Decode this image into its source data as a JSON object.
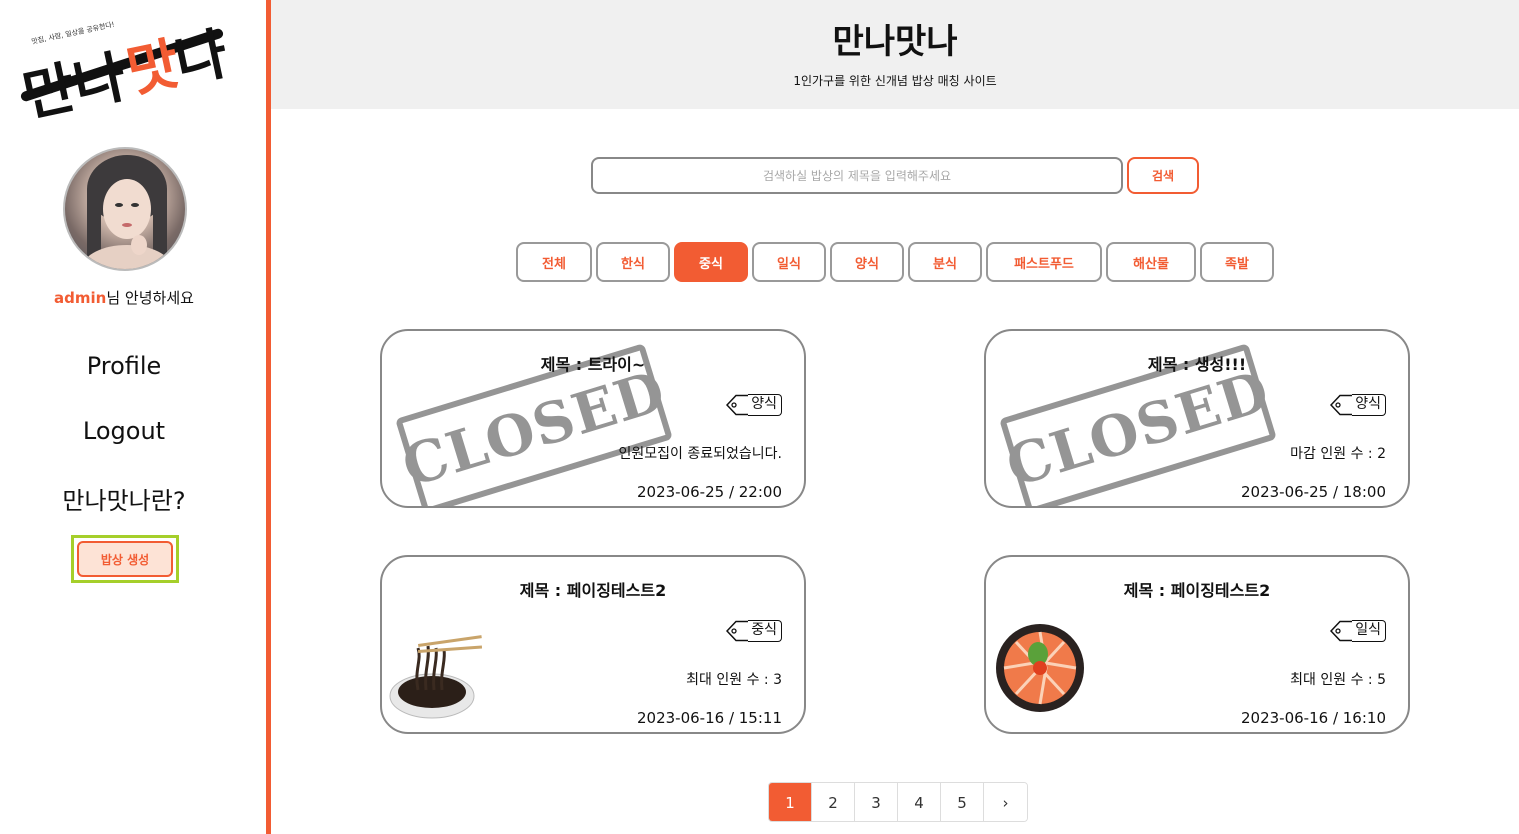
{
  "logo": {
    "tagline": "맛집, 사람, 일상을 공유한다!",
    "text_a": "만나",
    "text_b": "맛",
    "text_c": "나"
  },
  "sidebar": {
    "user": "admin",
    "greeting_suffix": "님 안녕하세요",
    "nav": {
      "profile": "Profile",
      "logout": "Logout",
      "about": "만나맛나란?"
    },
    "create_button": "밥상 생성"
  },
  "header": {
    "title": "만나맛나",
    "subtitle": "1인가구를 위한 신개념 밥상 매칭 사이트"
  },
  "search": {
    "placeholder": "검색하실 밥상의 제목을 입력해주세요",
    "button": "검색"
  },
  "categories": [
    "전체",
    "한식",
    "중식",
    "일식",
    "양식",
    "분식",
    "패스트푸드",
    "해산물",
    "족발"
  ],
  "active_category": "중식",
  "cards": [
    {
      "title": "제목 : 트라이~",
      "tag": "양식",
      "info": "인원모집이 종료되었습니다.",
      "date": "2023-06-25 / 22:00",
      "stamp": "CLOSED"
    },
    {
      "title": "제목 : 생성!!!",
      "tag": "양식",
      "info": "마감 인원 수 : 2",
      "date": "2023-06-25 / 18:00",
      "stamp": "CLOSED"
    },
    {
      "title": "제목 : 페이징테스트2",
      "tag": "중식",
      "info": "최대 인원 수 : 3",
      "date": "2023-06-16 / 15:11",
      "image": "jjajangmyeon-image"
    },
    {
      "title": "제목 : 페이징테스트2",
      "tag": "일식",
      "info": "최대 인원 수 : 5",
      "date": "2023-06-16 / 16:10",
      "image": "salmon-bowl-image"
    }
  ],
  "pagination": {
    "pages": [
      "1",
      "2",
      "3",
      "4",
      "5"
    ],
    "active": "1",
    "next": "›"
  },
  "colors": {
    "accent": "#f25c33",
    "highlight": "#a5cf2a",
    "header_bg": "#f0f0f0"
  }
}
